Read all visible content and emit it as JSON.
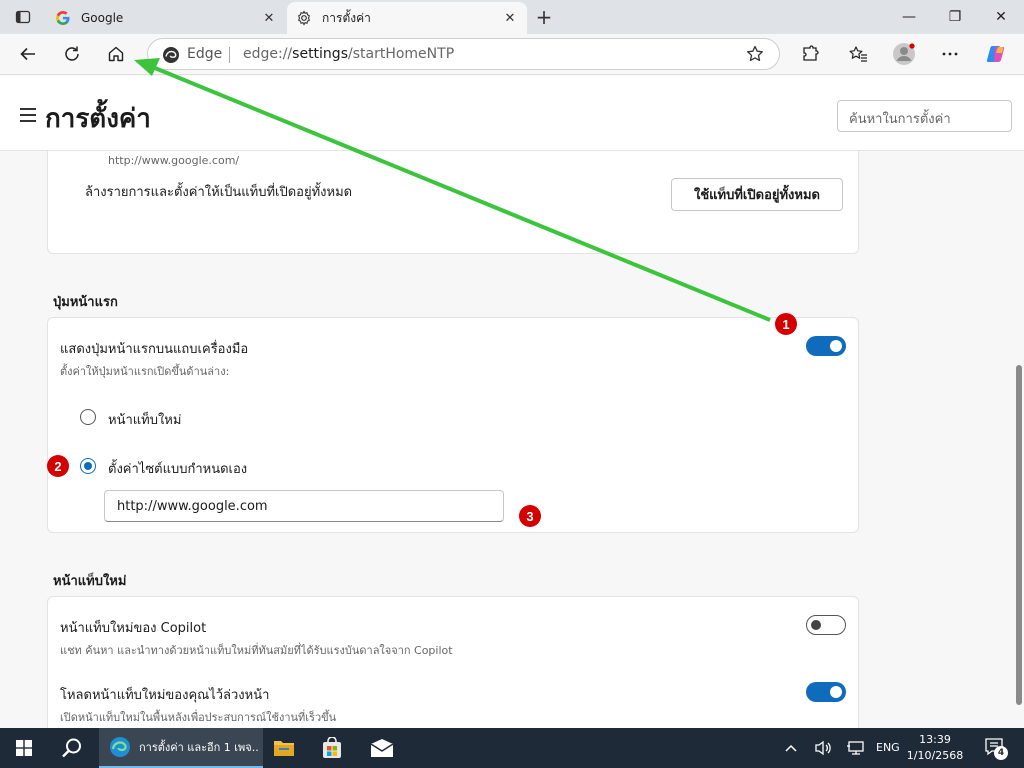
{
  "browser": {
    "tabs": [
      {
        "title": "Google",
        "active": false
      },
      {
        "title": "การตั้งค่า",
        "active": true
      }
    ],
    "edge_label": "Edge",
    "url_scheme": "edge://",
    "url_path": "settings",
    "url_rest": "/startHomeNTP"
  },
  "settings": {
    "title": "การตั้งค่า",
    "search_placeholder": "ค้นหาในการตั้งค่า",
    "startup_card": {
      "url_text": "http://www.google.com/",
      "reset_label": "ล้างรายการและตั้งค่าให้เป็นแท็บที่เปิดอยู่ทั้งหมด",
      "reset_button": "ใช้แท็บที่เปิดอยู่ทั้งหมด"
    },
    "home_section": {
      "title": "ปุ่มหน้าแรก",
      "show_home_title": "แสดงปุ่มหน้าแรกบนแถบเครื่องมือ",
      "show_home_sub": "ตั้งค่าให้ปุ่มหน้าแรกเปิดขึ้นด้านล่าง:",
      "show_home_on": true,
      "option_newtab": "หน้าแท็บใหม่",
      "option_custom": "ตั้งค่าไซต์แบบกำหนดเอง",
      "custom_url": "http://www.google.com"
    },
    "newtab_section": {
      "title": "หน้าแท็บใหม่",
      "copilot_title": "หน้าแท็บใหม่ของ Copilot",
      "copilot_sub": "แชท ค้นหา และนำทางด้วยหน้าแท็บใหม่ที่ทันสมัยที่ได้รับแรงบันดาลใจจาก Copilot",
      "copilot_on": false,
      "preload_title": "โหลดหน้าแท็บใหม่ของคุณไว้ล่วงหน้า",
      "preload_sub": "เปิดหน้าแท็บใหม่ในพื้นหลังเพื่อประสบการณ์ใช้งานที่เร็วขึ้น",
      "preload_on": true
    }
  },
  "annotations": {
    "marker_1": "1",
    "marker_2": "2",
    "marker_3": "3",
    "arrow_color": "#3cc43c",
    "marker_color": "#d40000"
  },
  "taskbar": {
    "app_label": "การตั้งค่า และอีก 1 เพจ...",
    "lang": "ENG",
    "time": "13:39",
    "date": "1/10/2568",
    "notification_count": "4"
  },
  "colors": {
    "accent": "#0f6cbd",
    "taskbar": "#1f2a38"
  }
}
